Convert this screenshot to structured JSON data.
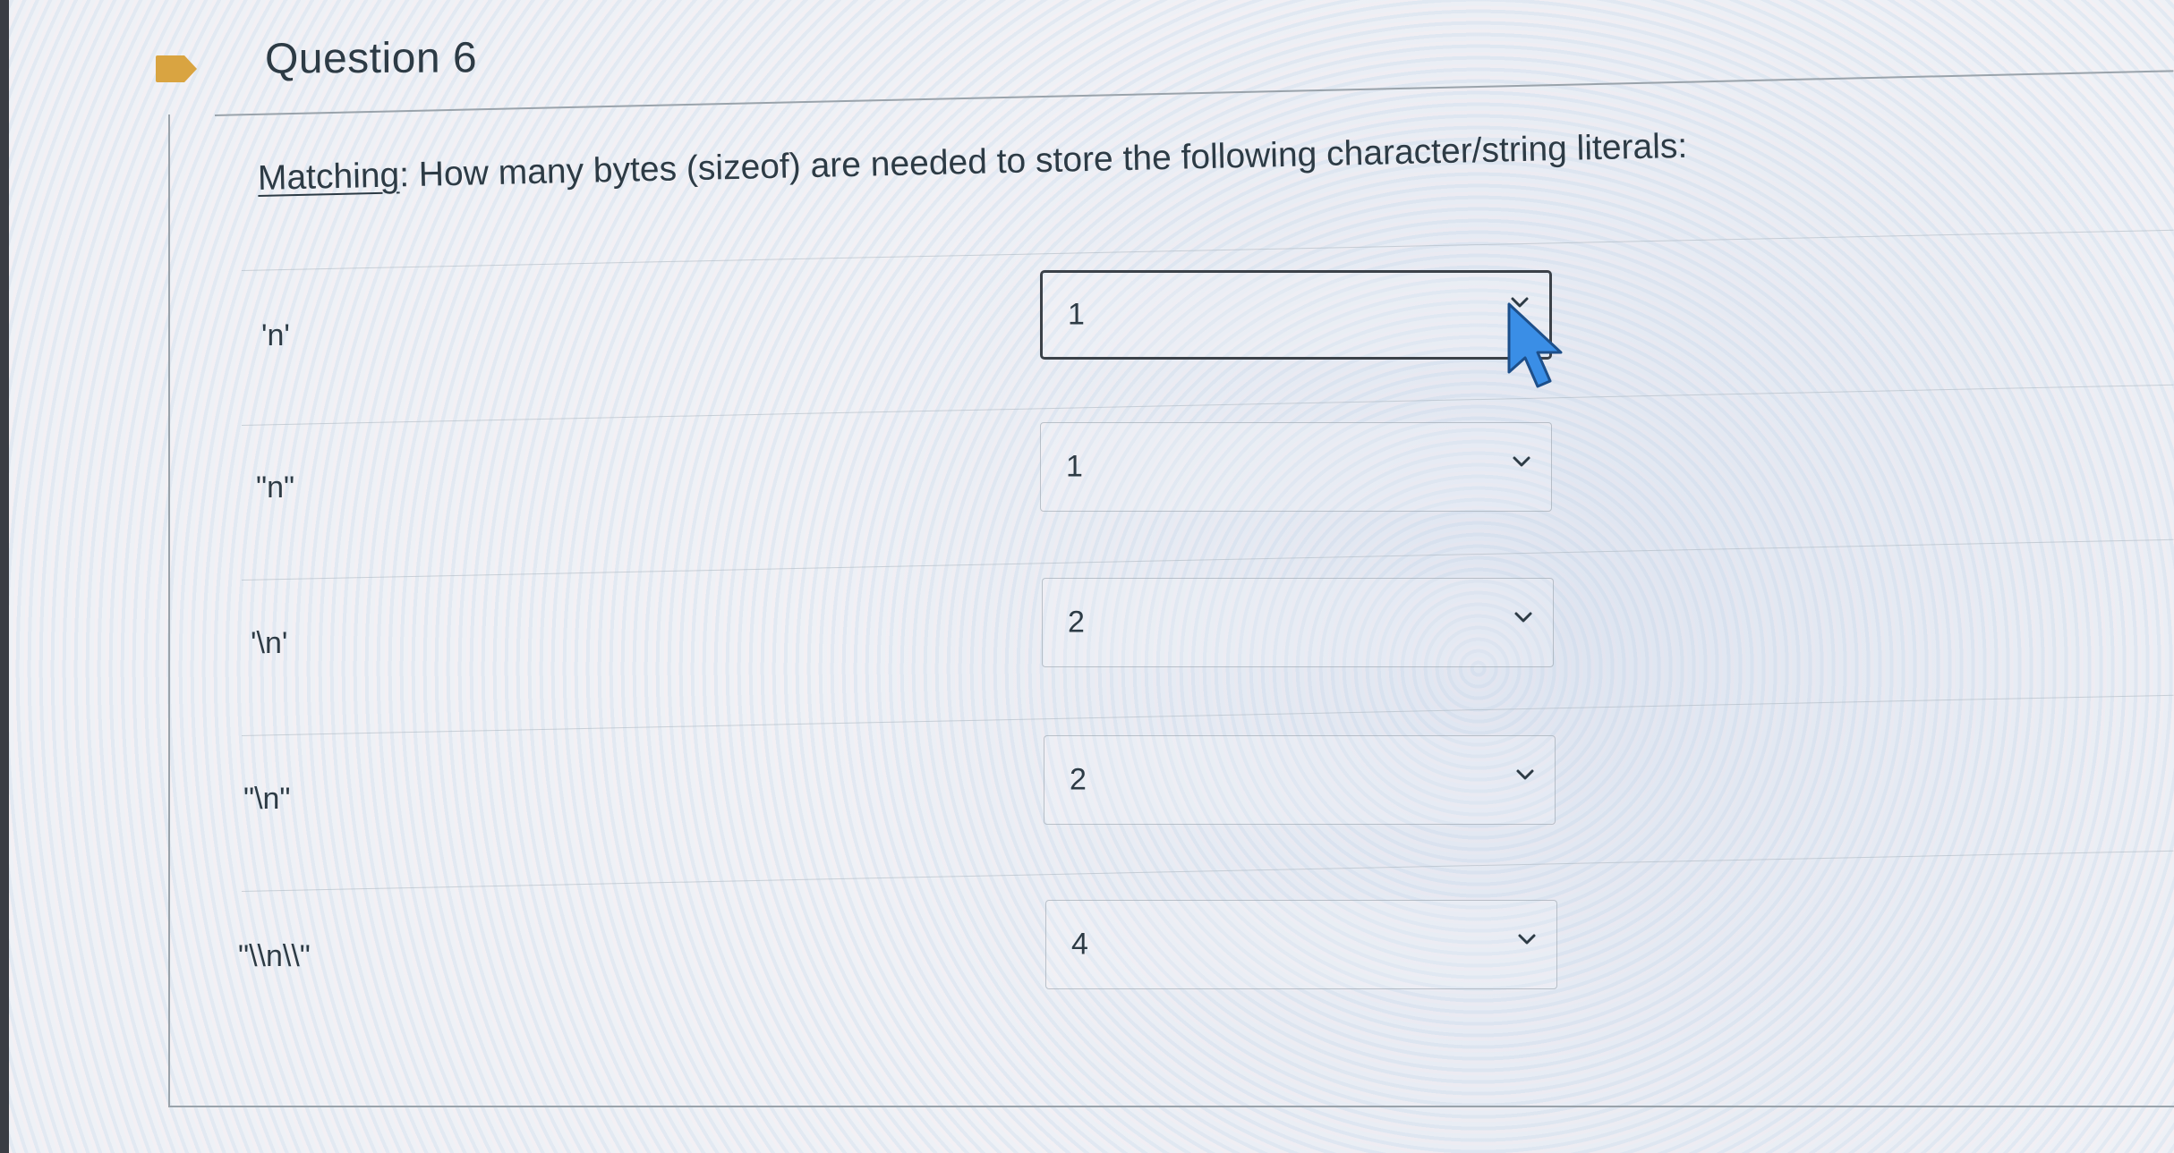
{
  "question": {
    "title": "Question 6",
    "prompt_kind": "Matching",
    "prompt_text": ": How many bytes (sizeof) are needed to store the following character/string literals:"
  },
  "items": [
    {
      "term": "'n'",
      "selected": "1",
      "focused": true
    },
    {
      "term": "\"n\"",
      "selected": "1",
      "focused": false
    },
    {
      "term": "'\\n'",
      "selected": "2",
      "focused": false
    },
    {
      "term": "\"\\n\"",
      "selected": "2",
      "focused": false
    },
    {
      "term": "\"\\\\n\\\\\"",
      "selected": "4",
      "focused": false
    }
  ],
  "icons": {
    "bookmark": "bookmark-flag-icon",
    "dropdown": "chevron-down-icon",
    "cursor": "mouse-pointer-icon"
  },
  "colors": {
    "bookmark": "#d9a441",
    "text": "#2d3b45",
    "cursor_fill": "#3a8ee6",
    "focus_border": "#3b4148"
  }
}
